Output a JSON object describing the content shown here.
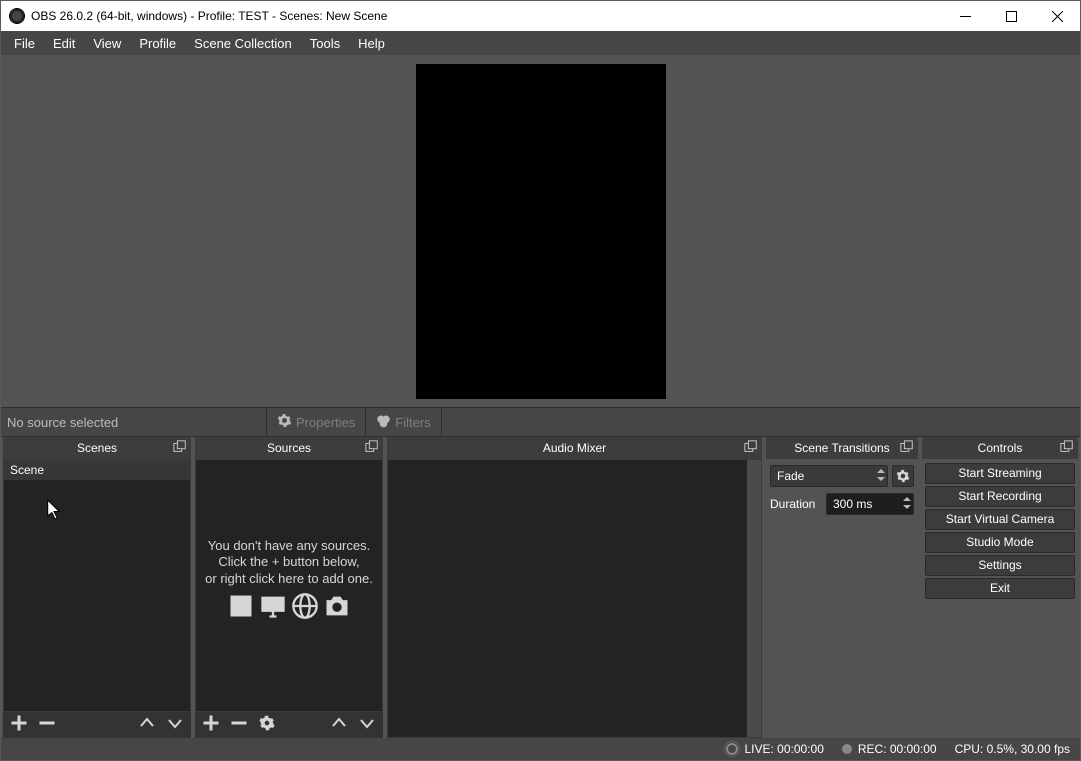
{
  "titlebar": {
    "title": "OBS 26.0.2 (64-bit, windows) - Profile: TEST - Scenes: New Scene"
  },
  "menubar": {
    "items": [
      "File",
      "Edit",
      "View",
      "Profile",
      "Scene Collection",
      "Tools",
      "Help"
    ]
  },
  "source_toolbar": {
    "no_selection": "No source selected",
    "properties": "Properties",
    "filters": "Filters"
  },
  "docks": {
    "scenes": {
      "title": "Scenes",
      "items": [
        "Scene"
      ]
    },
    "sources": {
      "title": "Sources",
      "empty_line1": "You don't have any sources.",
      "empty_line2": "Click the + button below,",
      "empty_line3": "or right click here to add one."
    },
    "mixer": {
      "title": "Audio Mixer"
    },
    "transitions": {
      "title": "Scene Transitions",
      "selected": "Fade",
      "duration_label": "Duration",
      "duration_value": "300 ms"
    },
    "controls": {
      "title": "Controls",
      "buttons": [
        "Start Streaming",
        "Start Recording",
        "Start Virtual Camera",
        "Studio Mode",
        "Settings",
        "Exit"
      ]
    }
  },
  "statusbar": {
    "live": "LIVE: 00:00:00",
    "rec": "REC: 00:00:00",
    "cpu": "CPU: 0.5%, 30.00 fps"
  }
}
